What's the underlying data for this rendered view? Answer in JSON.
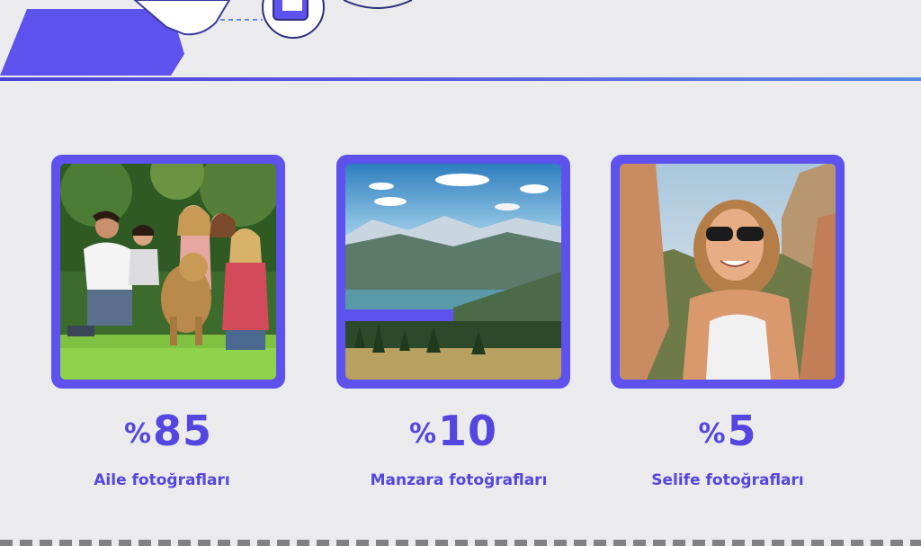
{
  "colors": {
    "accent": "#5d52ee",
    "text_accent": "#5546e0",
    "background": "#ebebed"
  },
  "stats": [
    {
      "percent_sign": "%",
      "value": "85",
      "label": "Aile fotoğrafları",
      "image": "family-photo"
    },
    {
      "percent_sign": "%",
      "value": "10",
      "label": "Manzara fotoğrafları",
      "image": "landscape-photo"
    },
    {
      "percent_sign": "%",
      "value": "5",
      "label": "Selife fotoğrafları",
      "image": "selfie-photo"
    }
  ]
}
